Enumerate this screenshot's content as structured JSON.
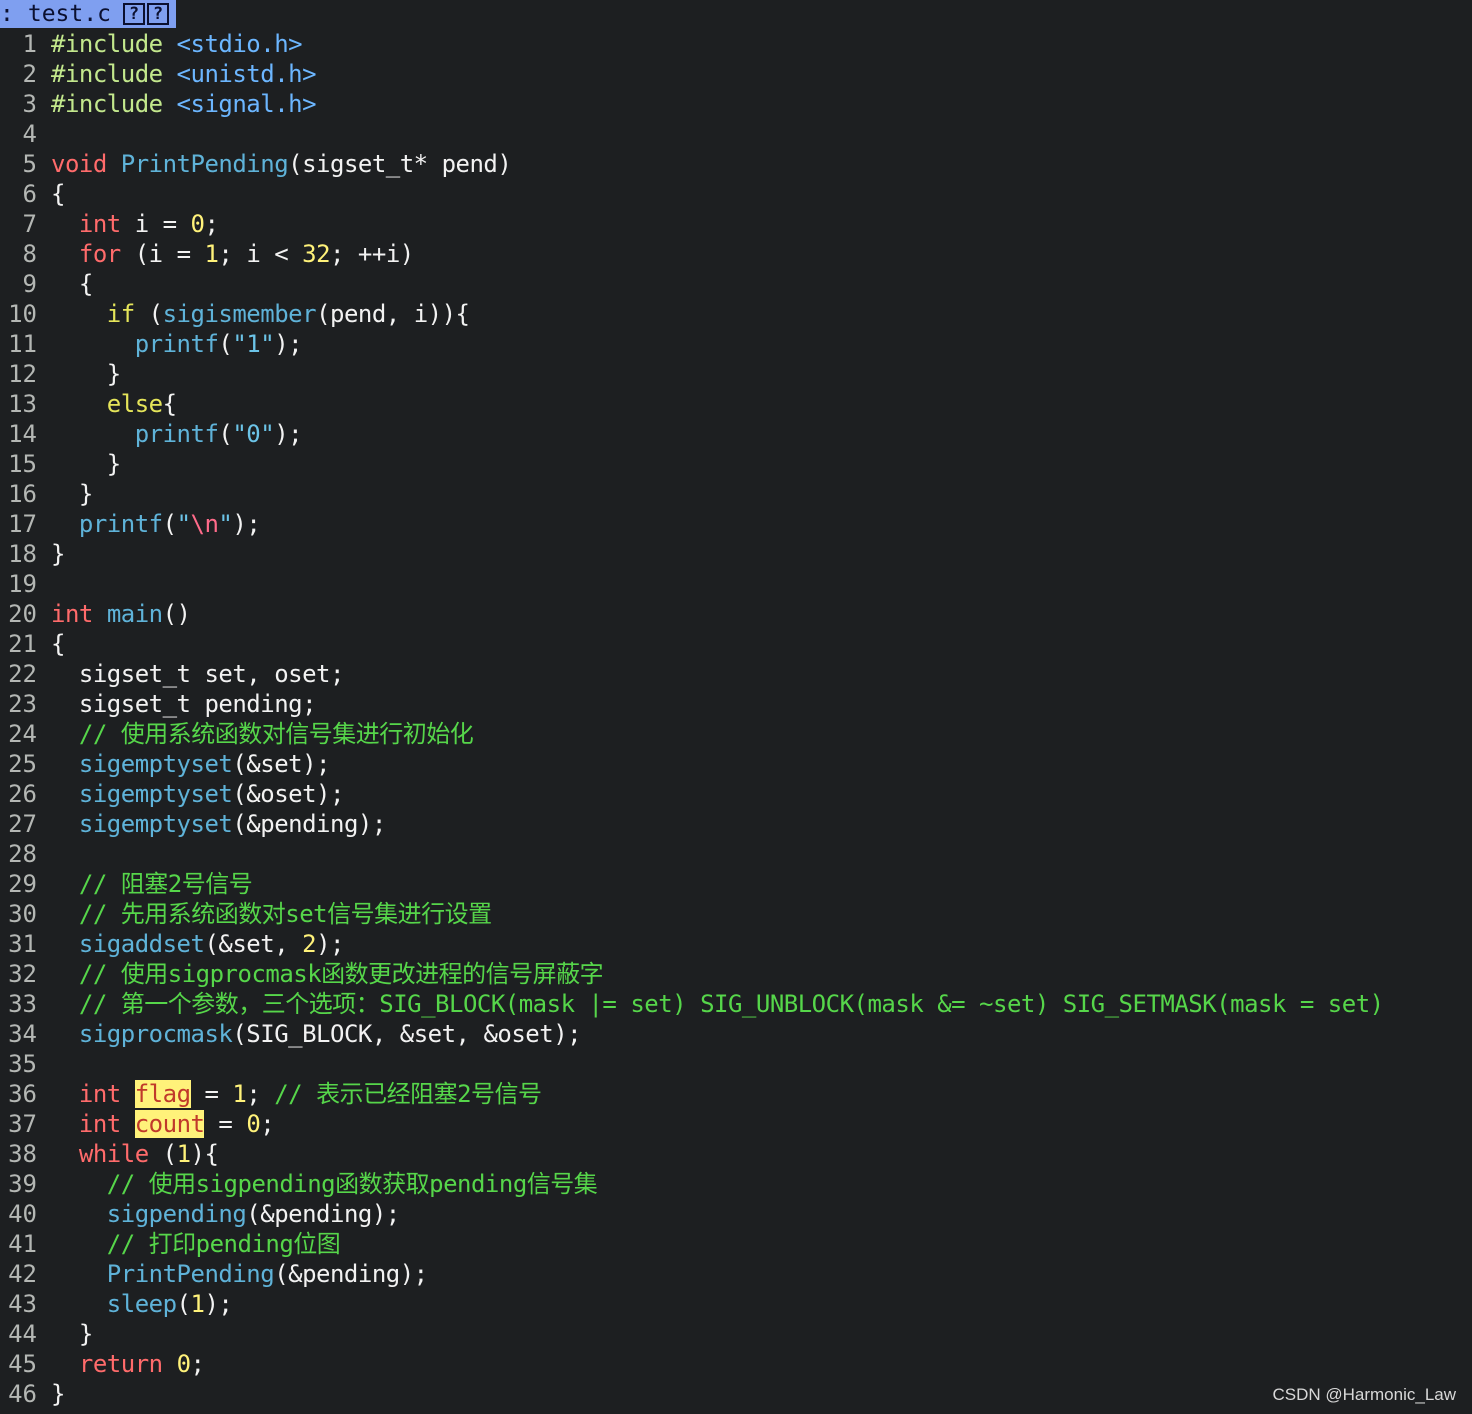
{
  "tab": {
    "separator": ":",
    "filename": "test.c",
    "icon1": "?",
    "icon2": "?"
  },
  "colors": {
    "background": "#1d1f21",
    "tab_bg": "#7f9ff0",
    "keyword": "#ff6b6b",
    "function": "#5fb3d9",
    "number": "#fff27a",
    "comment": "#56d64a",
    "preprocessor": "#c3e88d",
    "search_highlight": "#fff27a"
  },
  "lines": [
    {
      "n": "1",
      "tokens": [
        {
          "t": "#include ",
          "c": "pre"
        },
        {
          "t": "<stdio.h>",
          "c": "inc"
        }
      ]
    },
    {
      "n": "2",
      "tokens": [
        {
          "t": "#include ",
          "c": "pre"
        },
        {
          "t": "<unistd.h>",
          "c": "inc"
        }
      ]
    },
    {
      "n": "3",
      "tokens": [
        {
          "t": "#include ",
          "c": "pre"
        },
        {
          "t": "<signal.h>",
          "c": "inc"
        }
      ]
    },
    {
      "n": "4",
      "tokens": []
    },
    {
      "n": "5",
      "tokens": [
        {
          "t": "void ",
          "c": "type"
        },
        {
          "t": "PrintPending",
          "c": "fn"
        },
        {
          "t": "(sigset_t* pend)",
          "c": "plain"
        }
      ]
    },
    {
      "n": "6",
      "tokens": [
        {
          "t": "{",
          "c": "plain"
        }
      ]
    },
    {
      "n": "7",
      "tokens": [
        {
          "t": "  ",
          "c": "plain"
        },
        {
          "t": "int",
          "c": "type"
        },
        {
          "t": " i = ",
          "c": "plain"
        },
        {
          "t": "0",
          "c": "num"
        },
        {
          "t": ";",
          "c": "plain"
        }
      ]
    },
    {
      "n": "8",
      "tokens": [
        {
          "t": "  ",
          "c": "plain"
        },
        {
          "t": "for",
          "c": "kw"
        },
        {
          "t": " (i = ",
          "c": "plain"
        },
        {
          "t": "1",
          "c": "num"
        },
        {
          "t": "; i < ",
          "c": "plain"
        },
        {
          "t": "32",
          "c": "num"
        },
        {
          "t": "; ++i)",
          "c": "plain"
        }
      ]
    },
    {
      "n": "9",
      "tokens": [
        {
          "t": "  {",
          "c": "plain"
        }
      ]
    },
    {
      "n": "10",
      "tokens": [
        {
          "t": "    ",
          "c": "plain"
        },
        {
          "t": "if",
          "c": "kwy"
        },
        {
          "t": " (",
          "c": "plain"
        },
        {
          "t": "sigismember",
          "c": "fn"
        },
        {
          "t": "(pend, i)){",
          "c": "plain"
        }
      ]
    },
    {
      "n": "11",
      "tokens": [
        {
          "t": "      ",
          "c": "plain"
        },
        {
          "t": "printf",
          "c": "fn"
        },
        {
          "t": "(",
          "c": "plain"
        },
        {
          "t": "\"1\"",
          "c": "str"
        },
        {
          "t": ");",
          "c": "plain"
        }
      ]
    },
    {
      "n": "12",
      "tokens": [
        {
          "t": "    }",
          "c": "plain"
        }
      ]
    },
    {
      "n": "13",
      "tokens": [
        {
          "t": "    ",
          "c": "plain"
        },
        {
          "t": "else",
          "c": "kwy"
        },
        {
          "t": "{",
          "c": "plain"
        }
      ]
    },
    {
      "n": "14",
      "tokens": [
        {
          "t": "      ",
          "c": "plain"
        },
        {
          "t": "printf",
          "c": "fn"
        },
        {
          "t": "(",
          "c": "plain"
        },
        {
          "t": "\"0\"",
          "c": "str"
        },
        {
          "t": ");",
          "c": "plain"
        }
      ]
    },
    {
      "n": "15",
      "tokens": [
        {
          "t": "    }",
          "c": "plain"
        }
      ]
    },
    {
      "n": "16",
      "tokens": [
        {
          "t": "  }",
          "c": "plain"
        }
      ]
    },
    {
      "n": "17",
      "tokens": [
        {
          "t": "  ",
          "c": "plain"
        },
        {
          "t": "printf",
          "c": "fn"
        },
        {
          "t": "(",
          "c": "plain"
        },
        {
          "t": "\"",
          "c": "str"
        },
        {
          "t": "\\n",
          "c": "esc"
        },
        {
          "t": "\"",
          "c": "str"
        },
        {
          "t": ");",
          "c": "plain"
        }
      ]
    },
    {
      "n": "18",
      "tokens": [
        {
          "t": "}",
          "c": "plain"
        }
      ]
    },
    {
      "n": "19",
      "tokens": []
    },
    {
      "n": "20",
      "tokens": [
        {
          "t": "int",
          "c": "type"
        },
        {
          "t": " ",
          "c": "plain"
        },
        {
          "t": "main",
          "c": "fn"
        },
        {
          "t": "()",
          "c": "plain"
        }
      ]
    },
    {
      "n": "21",
      "tokens": [
        {
          "t": "{",
          "c": "plain"
        }
      ]
    },
    {
      "n": "22",
      "tokens": [
        {
          "t": "  sigset_t set, oset;",
          "c": "plain"
        }
      ]
    },
    {
      "n": "23",
      "tokens": [
        {
          "t": "  sigset_t pending;",
          "c": "plain"
        }
      ]
    },
    {
      "n": "24",
      "tokens": [
        {
          "t": "  // 使用系统函数对信号集进行初始化",
          "c": "cmt"
        }
      ]
    },
    {
      "n": "25",
      "tokens": [
        {
          "t": "  ",
          "c": "plain"
        },
        {
          "t": "sigemptyset",
          "c": "fn"
        },
        {
          "t": "(&set);",
          "c": "plain"
        }
      ]
    },
    {
      "n": "26",
      "tokens": [
        {
          "t": "  ",
          "c": "plain"
        },
        {
          "t": "sigemptyset",
          "c": "fn"
        },
        {
          "t": "(&oset);",
          "c": "plain"
        }
      ]
    },
    {
      "n": "27",
      "tokens": [
        {
          "t": "  ",
          "c": "plain"
        },
        {
          "t": "sigemptyset",
          "c": "fn"
        },
        {
          "t": "(&pending);",
          "c": "plain"
        }
      ]
    },
    {
      "n": "28",
      "tokens": []
    },
    {
      "n": "29",
      "tokens": [
        {
          "t": "  // 阻塞2号信号",
          "c": "cmt"
        }
      ]
    },
    {
      "n": "30",
      "tokens": [
        {
          "t": "  // 先用系统函数对set信号集进行设置",
          "c": "cmt"
        }
      ]
    },
    {
      "n": "31",
      "tokens": [
        {
          "t": "  ",
          "c": "plain"
        },
        {
          "t": "sigaddset",
          "c": "fn"
        },
        {
          "t": "(&set, ",
          "c": "plain"
        },
        {
          "t": "2",
          "c": "num"
        },
        {
          "t": ");",
          "c": "plain"
        }
      ]
    },
    {
      "n": "32",
      "tokens": [
        {
          "t": "  // 使用sigprocmask函数更改进程的信号屏蔽字",
          "c": "cmt"
        }
      ]
    },
    {
      "n": "33",
      "tokens": [
        {
          "t": "  // 第一个参数，三个选项：SIG_BLOCK(mask |= set) SIG_UNBLOCK(mask &= ~set) SIG_SETMASK(mask = set)",
          "c": "cmt"
        }
      ]
    },
    {
      "n": "34",
      "tokens": [
        {
          "t": "  ",
          "c": "plain"
        },
        {
          "t": "sigprocmask",
          "c": "fn"
        },
        {
          "t": "(SIG_BLOCK, &set, &oset);",
          "c": "plain"
        }
      ]
    },
    {
      "n": "35",
      "tokens": []
    },
    {
      "n": "36",
      "tokens": [
        {
          "t": "  ",
          "c": "plain"
        },
        {
          "t": "int",
          "c": "type"
        },
        {
          "t": " ",
          "c": "plain"
        },
        {
          "t": "flag",
          "c": "hl"
        },
        {
          "t": " = ",
          "c": "plain"
        },
        {
          "t": "1",
          "c": "num"
        },
        {
          "t": "; ",
          "c": "plain"
        },
        {
          "t": "// 表示已经阻塞2号信号",
          "c": "cmt"
        }
      ]
    },
    {
      "n": "37",
      "tokens": [
        {
          "t": "  ",
          "c": "plain"
        },
        {
          "t": "int",
          "c": "type"
        },
        {
          "t": " ",
          "c": "plain"
        },
        {
          "t": "count",
          "c": "hl"
        },
        {
          "t": " = ",
          "c": "plain"
        },
        {
          "t": "0",
          "c": "num"
        },
        {
          "t": ";",
          "c": "plain"
        }
      ]
    },
    {
      "n": "38",
      "tokens": [
        {
          "t": "  ",
          "c": "plain"
        },
        {
          "t": "while",
          "c": "kw"
        },
        {
          "t": " (",
          "c": "plain"
        },
        {
          "t": "1",
          "c": "num"
        },
        {
          "t": "){",
          "c": "plain"
        }
      ]
    },
    {
      "n": "39",
      "tokens": [
        {
          "t": "    // 使用sigpending函数获取pending信号集",
          "c": "cmt"
        }
      ]
    },
    {
      "n": "40",
      "tokens": [
        {
          "t": "    ",
          "c": "plain"
        },
        {
          "t": "sigpending",
          "c": "fn"
        },
        {
          "t": "(&pending);",
          "c": "plain"
        }
      ]
    },
    {
      "n": "41",
      "tokens": [
        {
          "t": "    // 打印pending位图",
          "c": "cmt"
        }
      ]
    },
    {
      "n": "42",
      "tokens": [
        {
          "t": "    ",
          "c": "plain"
        },
        {
          "t": "PrintPending",
          "c": "fn"
        },
        {
          "t": "(&pending);",
          "c": "plain"
        }
      ]
    },
    {
      "n": "43",
      "tokens": [
        {
          "t": "    ",
          "c": "plain"
        },
        {
          "t": "sleep",
          "c": "fn"
        },
        {
          "t": "(",
          "c": "plain"
        },
        {
          "t": "1",
          "c": "num"
        },
        {
          "t": ");",
          "c": "plain"
        }
      ]
    },
    {
      "n": "44",
      "tokens": [
        {
          "t": "  }",
          "c": "plain"
        }
      ]
    },
    {
      "n": "45",
      "tokens": [
        {
          "t": "  ",
          "c": "plain"
        },
        {
          "t": "return",
          "c": "kw"
        },
        {
          "t": " ",
          "c": "plain"
        },
        {
          "t": "0",
          "c": "num"
        },
        {
          "t": ";",
          "c": "plain"
        }
      ]
    },
    {
      "n": "46",
      "tokens": [
        {
          "t": "}",
          "c": "plain"
        }
      ]
    }
  ],
  "watermark": "CSDN @Harmonic_Law"
}
